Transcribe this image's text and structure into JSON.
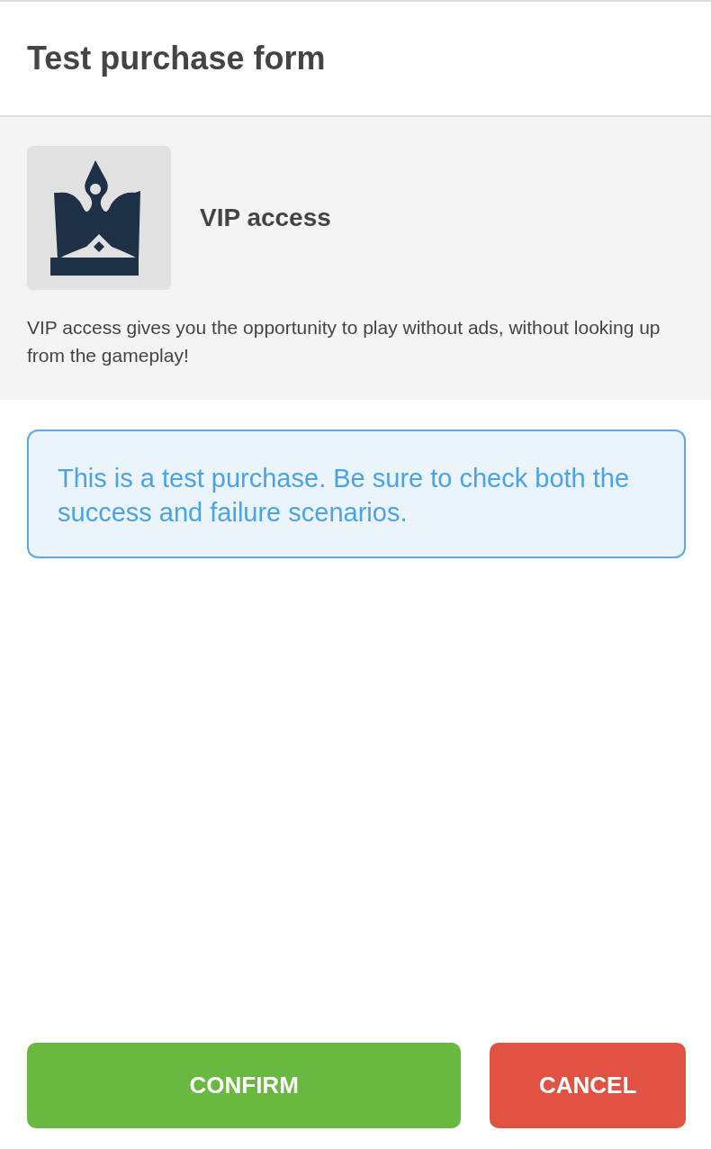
{
  "header": {
    "title": "Test purchase form"
  },
  "product": {
    "name": "VIP access",
    "description": "VIP access gives you the opportunity to play without ads, without looking up from the gameplay!"
  },
  "notice": {
    "text": "This is a test purchase. Be sure to check both the success and failure scenarios."
  },
  "buttons": [
    {
      "label": "CONFIRM",
      "kind": "primary"
    },
    {
      "label": "CANCEL",
      "kind": "danger"
    }
  ]
}
